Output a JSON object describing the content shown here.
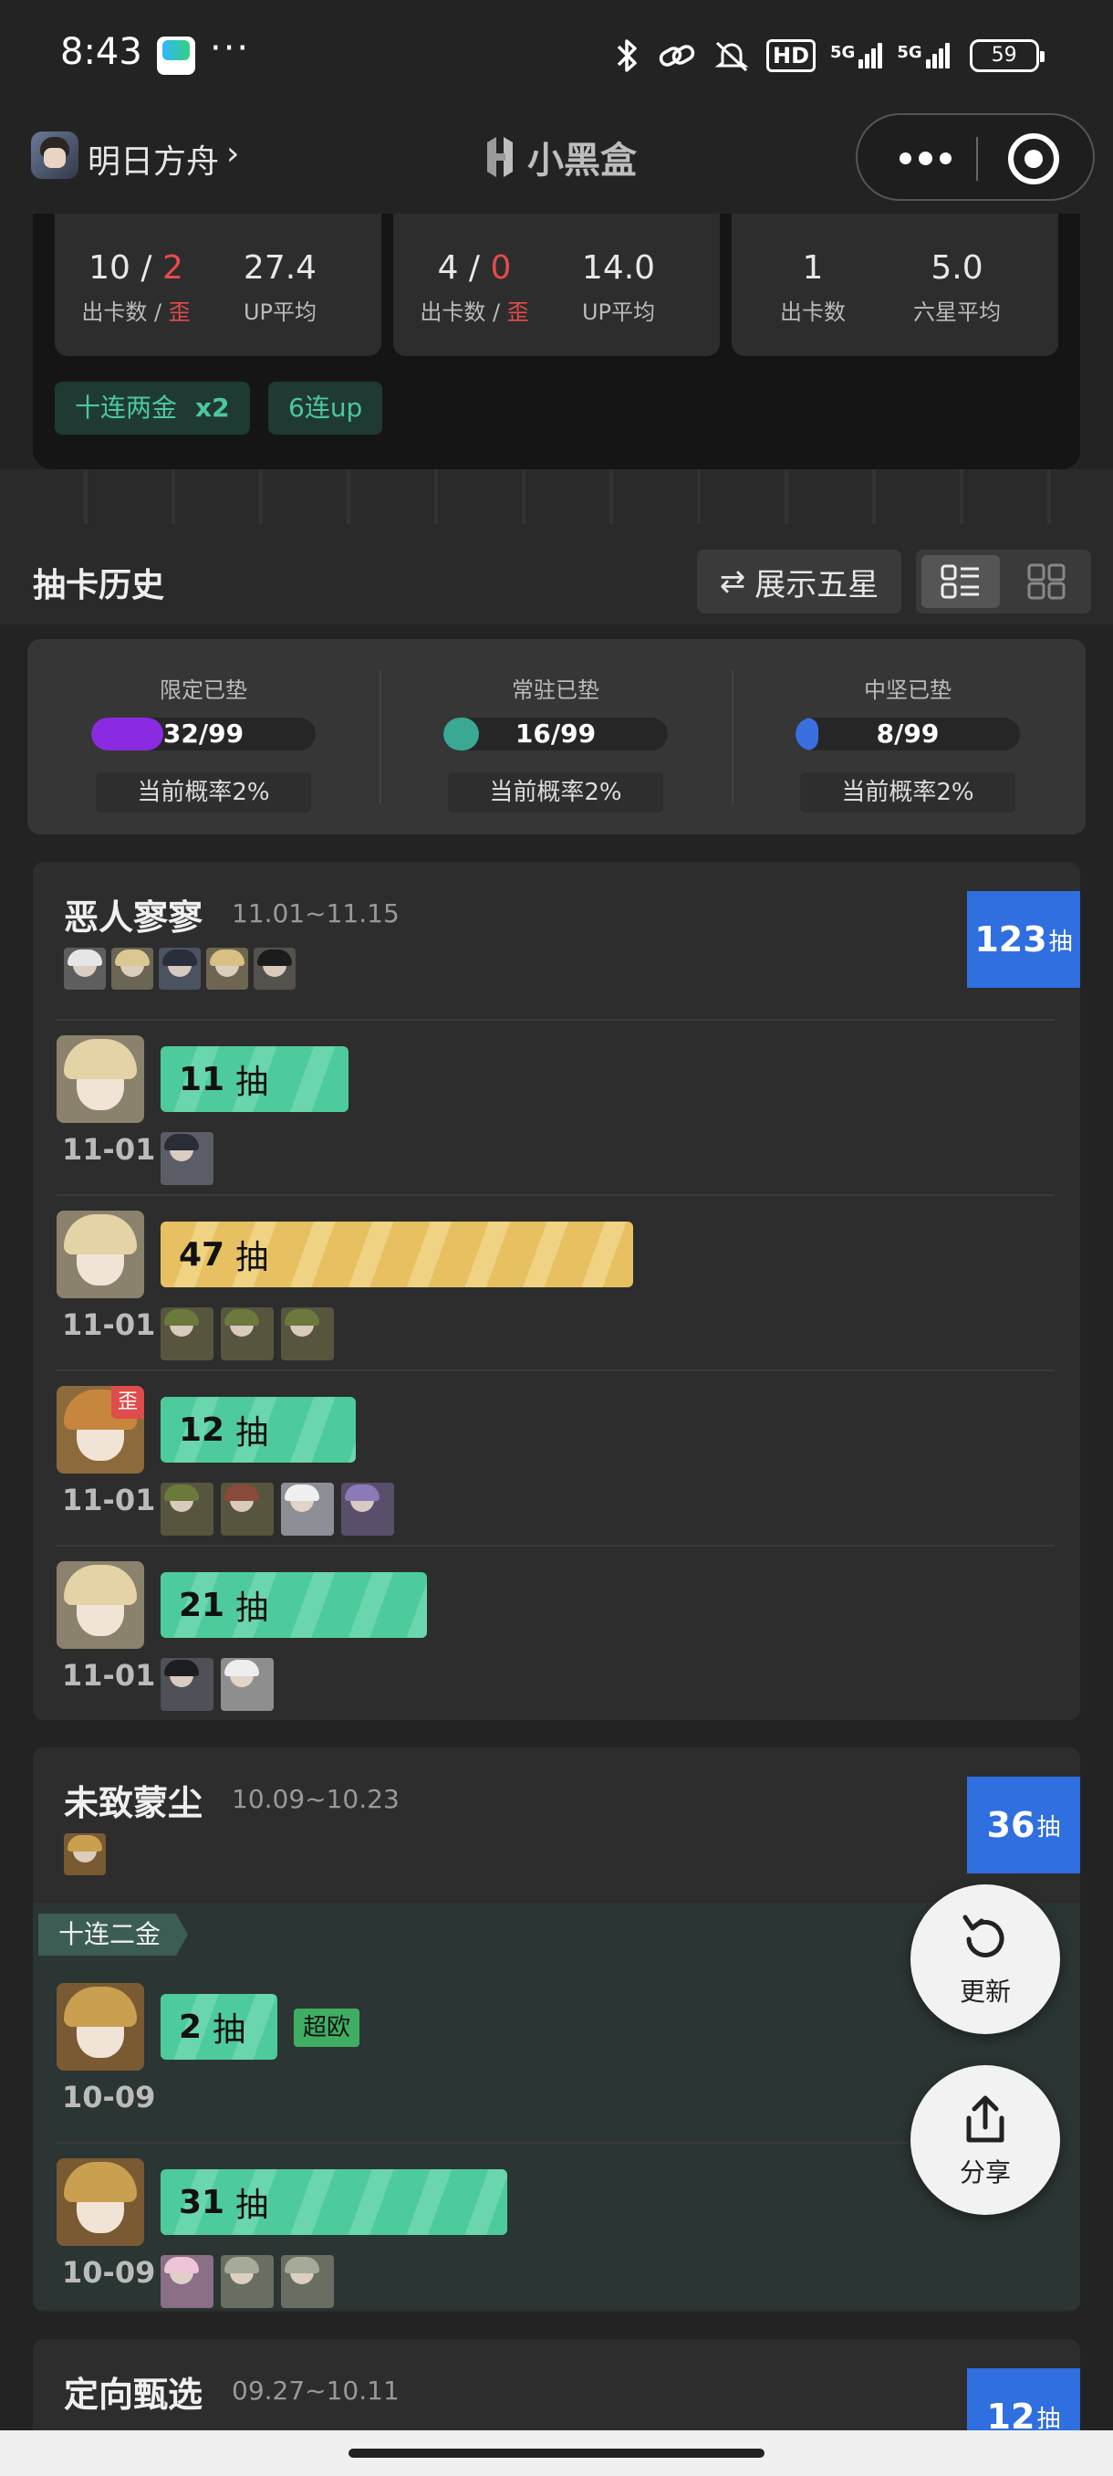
{
  "status_bar": {
    "time": "8:43",
    "more": "···",
    "hd": "HD",
    "net1": "5G",
    "net2": "5G",
    "battery": "59"
  },
  "nav": {
    "game": "明日方舟",
    "chevron": "›",
    "title": "小黑盒"
  },
  "summary": {
    "cards": [
      {
        "a_val": "10",
        "a_red": "2",
        "a_lbl": "出卡数",
        "a_lbl_red": "歪",
        "b_val": "27.4",
        "b_lbl": "UP平均"
      },
      {
        "a_val": "4",
        "a_red": "0",
        "a_lbl": "出卡数",
        "a_lbl_red": "歪",
        "b_val": "14.0",
        "b_lbl": "UP平均"
      },
      {
        "a_val": "1",
        "a_lbl": "出卡数",
        "b_val": "5.0",
        "b_lbl": "六星平均"
      }
    ],
    "tags": [
      {
        "label": "十连两金",
        "extra": "x2"
      },
      {
        "label": "6连up"
      }
    ]
  },
  "history": {
    "title": "抽卡历史",
    "show5": "展示五星",
    "show5_icon": "⇄"
  },
  "pity": [
    {
      "label": "限定已垫",
      "value": "32/99",
      "progress": 0.32,
      "color": "#8a2be2",
      "rate": "当前概率2%"
    },
    {
      "label": "常驻已垫",
      "value": "16/99",
      "progress": 0.16,
      "color": "#3aa892",
      "rate": "当前概率2%"
    },
    {
      "label": "中坚已垫",
      "value": "8/99",
      "progress": 0.08,
      "color": "#3a6fe0",
      "rate": "当前概率2%"
    }
  ],
  "banners": [
    {
      "name": "恶人寥寥",
      "date": "11.01~11.15",
      "total": "123",
      "unit": "抽",
      "pulls": [
        {
          "count": "11",
          "unit": "抽",
          "date": "11-01",
          "color": "green",
          "wai": ""
        },
        {
          "count": "47",
          "unit": "抽",
          "date": "11-01",
          "color": "gold",
          "wai": ""
        },
        {
          "count": "12",
          "unit": "抽",
          "date": "11-01",
          "color": "green",
          "wai": "歪"
        },
        {
          "count": "21",
          "unit": "抽",
          "date": "11-01",
          "color": "green",
          "wai": ""
        }
      ]
    },
    {
      "name": "未致蒙尘",
      "date": "10.09~10.23",
      "total": "36",
      "unit": "抽",
      "tenpull_label": "十连二金",
      "pulls": [
        {
          "count": "2",
          "unit": "抽",
          "date": "10-09",
          "color": "green",
          "badge": "超欧"
        },
        {
          "count": "31",
          "unit": "抽",
          "date": "10-09",
          "color": "green"
        }
      ]
    },
    {
      "name": "定向甄选",
      "date": "09.27~10.11",
      "total": "12",
      "unit": "抽"
    }
  ],
  "fab": {
    "refresh": "更新",
    "share": "分享"
  }
}
